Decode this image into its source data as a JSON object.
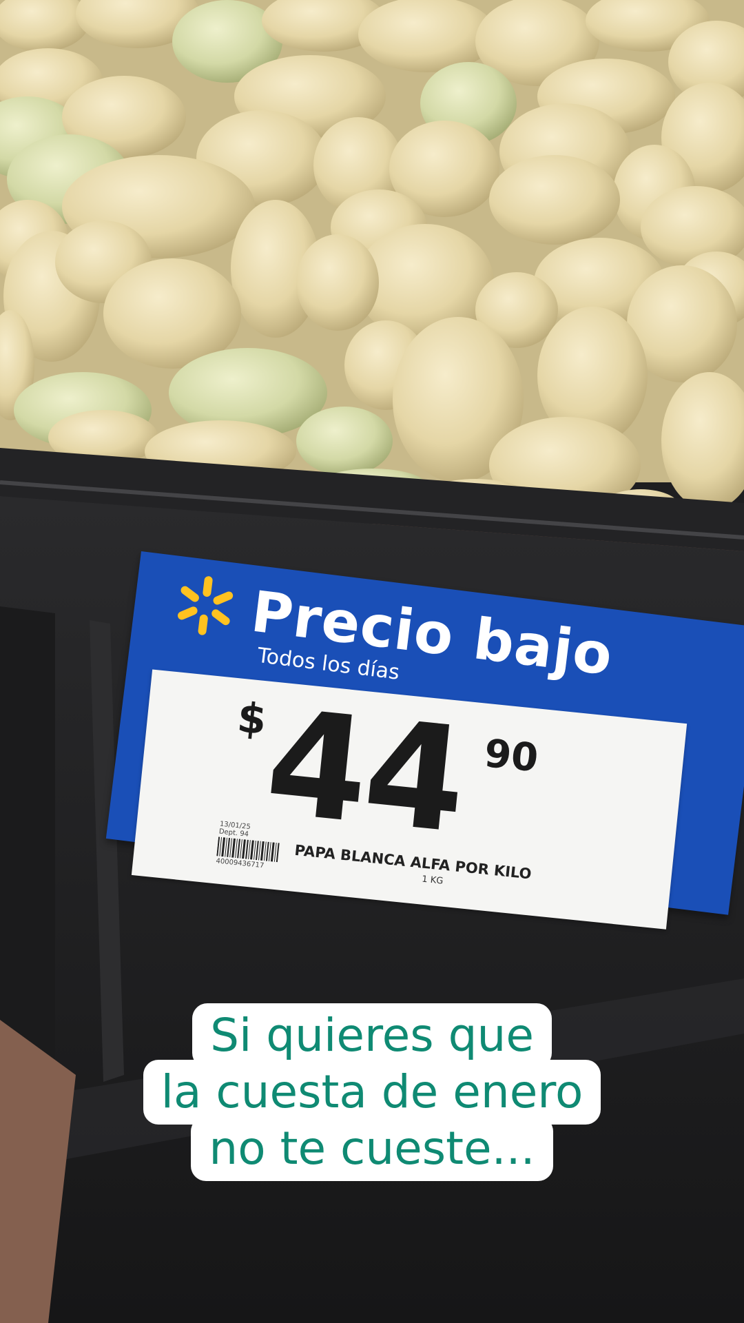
{
  "sign": {
    "title": "Precio bajo",
    "subtitle": "Todos los días",
    "currency": "$",
    "price_main": "44",
    "price_cents": "90",
    "date_line1": "13/01/25",
    "date_line2": "Dept. 94",
    "barcode_number": "40009436717",
    "product_name": "PAPA BLANCA ALFA POR KILO",
    "product_unit": "1 KG",
    "colors": {
      "background": "#1a4fb7",
      "text": "#ffffff",
      "spark": "#ffc220",
      "card": "#f5f5f3"
    }
  },
  "caption": {
    "lines": [
      "Si quieres que",
      "la cuesta de enero",
      "no te cueste..."
    ],
    "colors": {
      "text": "#0f8a73",
      "background": "#ffffff"
    }
  }
}
